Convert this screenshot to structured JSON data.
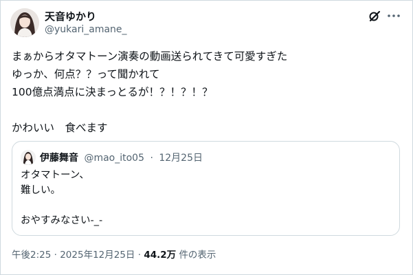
{
  "author": {
    "name": "天音ゆかり",
    "handle": "@yukari_amane_"
  },
  "icons": {
    "avatar": "avatar",
    "grok": "grok-icon",
    "more": "more-icon"
  },
  "post": {
    "text": "まぁからオタマトーン演奏の動画送られてきて可愛すぎた\nゆっか、何点？？って聞かれて\n100億点満点に決まっとるが！？！？！？\n\nかわいい　食べます"
  },
  "quote": {
    "name": "伊藤舞音",
    "handle": "@mao_ito05",
    "separator": "·",
    "date": "12月25日",
    "text": "オタマトーン、\n難しい。\n\nおやすみなさい-_-"
  },
  "footer": {
    "time": "午後2:25",
    "sep1": "·",
    "date": "2025年12月25日",
    "sep2": "·",
    "views": "44.2万",
    "views_label": "件の表示"
  }
}
